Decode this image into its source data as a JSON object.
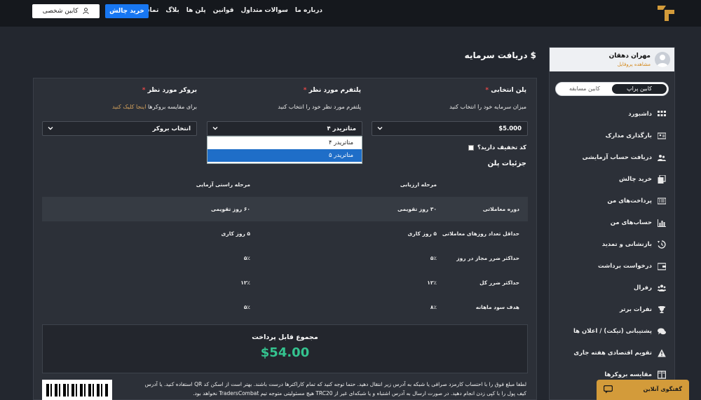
{
  "nav": {
    "links": [
      "درباره ما",
      "سوالات متداول",
      "قوانین",
      "پلن ها",
      "بلاگ",
      "تماس با ما"
    ],
    "buy_label": "خرید چالش",
    "cabinet_label": "کابین شخصی"
  },
  "sidebar": {
    "user_name": "مهران دهقان",
    "profile_link": "مشاهده پروفایل",
    "toggle": {
      "active": "کابین پراپ",
      "other": "کابین مسابقه"
    },
    "items": [
      {
        "label": "داشبورد",
        "icon": "grid-icon"
      },
      {
        "label": "بارگذاری مدارک",
        "icon": "id-card-icon"
      },
      {
        "label": "دریافت حساب آزمایشی",
        "icon": "users-icon"
      },
      {
        "label": "خرید چالش",
        "icon": "copy-icon"
      },
      {
        "label": "پرداخت‌های من",
        "icon": "receipt-icon"
      },
      {
        "label": "حساب‌های من",
        "icon": "bar-chart-icon"
      },
      {
        "label": "بازنشانی و تمدید",
        "icon": "history-icon"
      },
      {
        "label": "درخواست برداشت",
        "icon": "wallet-icon"
      },
      {
        "label": "رفرال",
        "icon": "group-icon"
      },
      {
        "label": "نفرات برتر",
        "icon": "trophy-icon"
      },
      {
        "label": "پشتیبانی (تیکت) / اعلان ها",
        "icon": "chat-icon"
      },
      {
        "label": "تقویم اقتصادی هفته جاری",
        "icon": "warning-icon"
      },
      {
        "label": "مقایسه بروکرها",
        "icon": "columns-icon"
      }
    ]
  },
  "page": {
    "title": "$ دریافت سرمایه"
  },
  "form": {
    "plan": {
      "label": "پلن انتخابی",
      "sub": "میزان سرمایه خود را انتخاب کنید",
      "value": "$5.000"
    },
    "platform": {
      "label": "پلتفرم مورد نظر",
      "sub": "پلتفرم مورد نظر خود را انتخاب کنید",
      "value": "متاتریدر ۴",
      "options": [
        "متاتریدر ۴",
        "متاتریدر ۵"
      ]
    },
    "broker": {
      "label": "بروکر مورد نظر",
      "sub": "برای مقایسه بروکرها",
      "sub_link": "اینجا کلیک کنید",
      "value": "انتخاب بروکر"
    },
    "discount_label": "کد تخفیف دارید؟"
  },
  "details": {
    "title": "جزئیات پلن",
    "headers": [
      "",
      "مرحله ارزیابی",
      "مرحله راستی آزمایی"
    ],
    "rows": [
      [
        "دوره معاملاتی",
        "۳۰ روز تقویمی",
        "۶۰ روز تقویمی"
      ],
      [
        "حداقل تعداد روزهای معاملاتی",
        "۵ روز کاری",
        "۵ روز کاری"
      ],
      [
        "حداکثر ضرر مجاز در روز",
        "۵٪",
        "۵٪"
      ],
      [
        "حداکثر ضرر کل",
        "۱۲٪",
        "۱۲٪"
      ],
      [
        "هدف سود ماهانه",
        "۸٪",
        "۵٪"
      ]
    ]
  },
  "total": {
    "label": "مجموع قابل پرداخت",
    "amount": "$54.00"
  },
  "note": "لطفا مبلغ فوق را با احتساب کارمزد صرافی یا شبکه به آدرس زیر انتقال دهید. حتما توجه کنید که تمام کاراکترها درست باشند. بهتر است از اسکن کد QR استفاده کنید. یا آدرس کیف پول را با کپی زدن انجام دهید. در صورت ارسال به آدرس اشتباه و یا شبکه‌ای غیر از TRC20 هیچ مسئولیتی متوجه تیم TradersCombat نخواهد بود.",
  "chat": {
    "label": "گفتگوی آنلاین"
  },
  "colors": {
    "accent": "#1877f2",
    "success": "#34c38f",
    "chat": "#d39b3a"
  }
}
